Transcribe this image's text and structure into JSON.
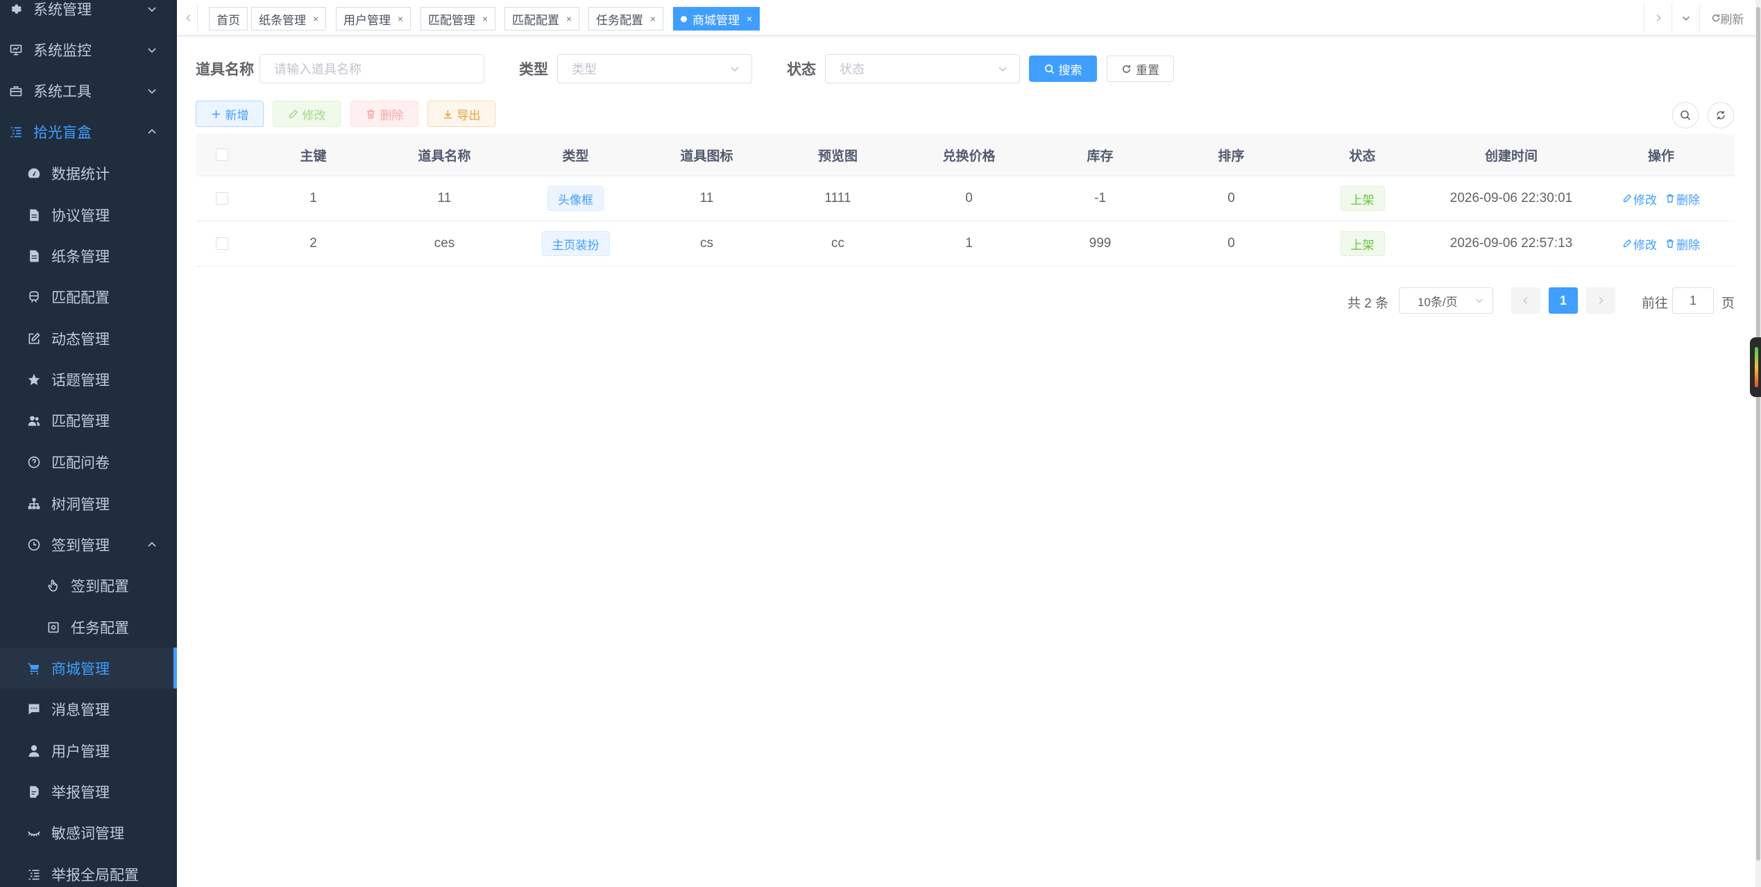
{
  "sidebar": {
    "items": [
      {
        "label": "系统管理",
        "icon": "gear-icon"
      },
      {
        "label": "系统监控",
        "icon": "monitor-icon"
      },
      {
        "label": "系统工具",
        "icon": "toolbox-icon"
      },
      {
        "label": "拾光盲盒",
        "icon": "list-tree-icon"
      },
      {
        "label": "数据统计",
        "icon": "dashboard-icon"
      },
      {
        "label": "协议管理",
        "icon": "document-icon"
      },
      {
        "label": "纸条管理",
        "icon": "document-icon"
      },
      {
        "label": "匹配配置",
        "icon": "train-icon"
      },
      {
        "label": "动态管理",
        "icon": "edit-icon"
      },
      {
        "label": "话题管理",
        "icon": "star-icon"
      },
      {
        "label": "匹配管理",
        "icon": "users-icon"
      },
      {
        "label": "匹配问卷",
        "icon": "question-icon"
      },
      {
        "label": "树洞管理",
        "icon": "tree-icon"
      },
      {
        "label": "签到管理",
        "icon": "clock-icon"
      },
      {
        "label": "签到配置",
        "icon": "hand-icon"
      },
      {
        "label": "任务配置",
        "icon": "task-icon"
      },
      {
        "label": "商城管理",
        "icon": "cart-icon"
      },
      {
        "label": "消息管理",
        "icon": "message-icon"
      },
      {
        "label": "用户管理",
        "icon": "user-icon"
      },
      {
        "label": "举报管理",
        "icon": "report-icon"
      },
      {
        "label": "敏感词管理",
        "icon": "eye-closed-icon"
      },
      {
        "label": "举报全局配置",
        "icon": "list-icon"
      }
    ]
  },
  "tags": {
    "items": [
      "首页",
      "纸条管理",
      "用户管理",
      "匹配管理",
      "匹配配置",
      "任务配置",
      "商城管理"
    ],
    "close": "×",
    "refresh": "刷新"
  },
  "search": {
    "name_label": "道具名称",
    "name_placeholder": "请输入道具名称",
    "type_label": "类型",
    "type_placeholder": "类型",
    "status_label": "状态",
    "status_placeholder": "状态",
    "search_btn": "搜索",
    "reset_btn": "重置"
  },
  "toolbar": {
    "add": "新增",
    "edit": "修改",
    "delete": "删除",
    "export": "导出"
  },
  "table": {
    "headers": [
      "主键",
      "道具名称",
      "类型",
      "道具图标",
      "预览图",
      "兑换价格",
      "库存",
      "排序",
      "状态",
      "创建时间",
      "操作"
    ],
    "rows": [
      {
        "id": "1",
        "name": "11",
        "type": "头像框",
        "icon": "11",
        "preview": "1111",
        "price": "0",
        "stock": "-1",
        "sort": "0",
        "status": "上架",
        "created": "2026-09-06 22:30:01"
      },
      {
        "id": "2",
        "name": "ces",
        "type": "主页装扮",
        "icon": "cs",
        "preview": "cc",
        "price": "1",
        "stock": "999",
        "sort": "0",
        "status": "上架",
        "created": "2026-09-06 22:57:13"
      }
    ],
    "op_edit": "修改",
    "op_delete": "删除"
  },
  "pagination": {
    "total": "共 2 条",
    "size": "10条/页",
    "current": "1",
    "goto": "前往",
    "goto_value": "1",
    "page_unit": "页"
  },
  "colors": {
    "primary": "#409eff",
    "sidebar_bg": "#1f2d3d",
    "success": "#67c23a"
  }
}
